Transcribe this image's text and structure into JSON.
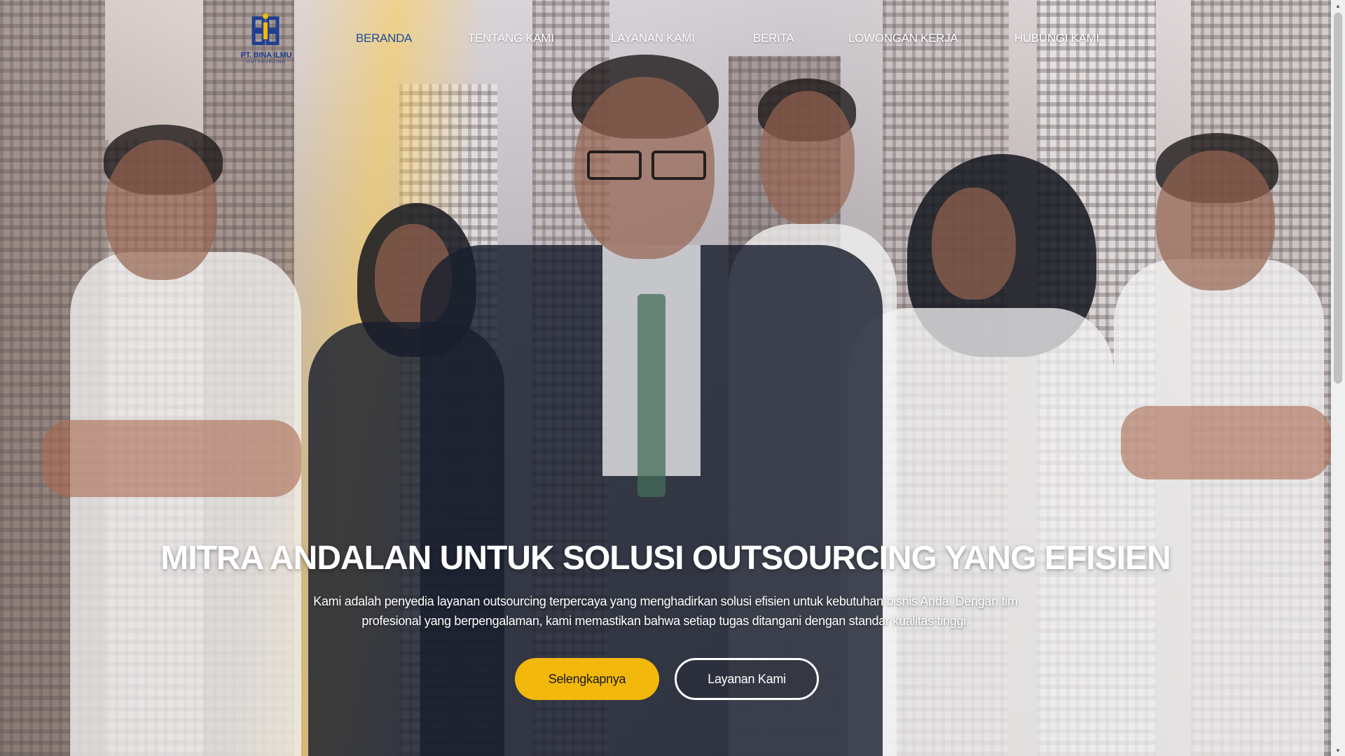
{
  "brand": {
    "name": "PT. BINA ILMU",
    "tagline": "OUTSOURCING",
    "primary_color": "#1f3f8f",
    "accent_color": "#f2b80c"
  },
  "nav": {
    "items": [
      {
        "label": "BERANDA",
        "active": true
      },
      {
        "label": "TENTANG KAMI",
        "active": false
      },
      {
        "label": "LAYANAN KAMI",
        "active": false
      },
      {
        "label": "BERITA",
        "active": false
      },
      {
        "label": "LOWONGAN KERJA",
        "active": false
      },
      {
        "label": "HUBUNGI KAMI",
        "active": false
      }
    ]
  },
  "hero": {
    "headline": "MITRA ANDALAN UNTUK SOLUSI OUTSOURCING YANG EFISIEN",
    "description_line1": "Kami adalah penyedia layanan outsourcing terpercaya yang menghadirkan solusi efisien untuk kebutuhan bisnis Anda. Dengan tim",
    "description_line2": "profesional yang berpengalaman, kami memastikan bahwa setiap tugas ditangani dengan standar kualitas tinggi.",
    "primary_button": "Selengkapnya",
    "secondary_button": "Layanan Kami"
  },
  "scrollbar": {
    "up_icon": "▲",
    "down_icon": "▼"
  }
}
